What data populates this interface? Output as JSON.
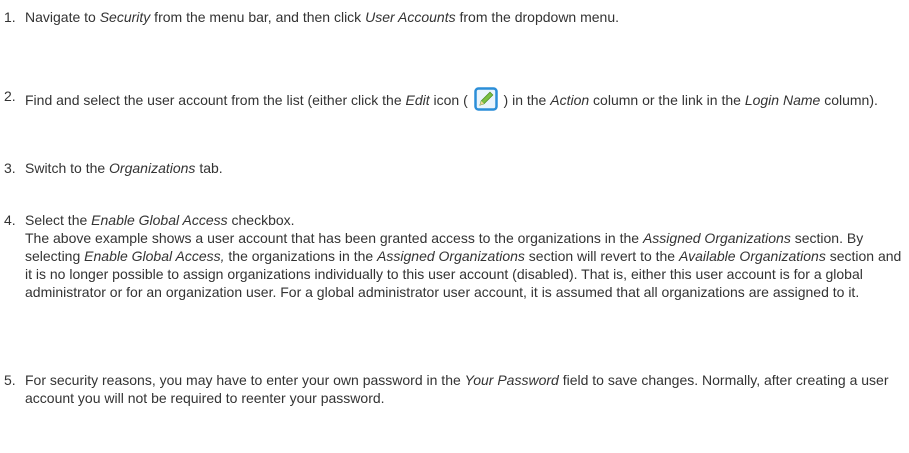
{
  "steps": [
    {
      "number": "1.",
      "parts": [
        "Navigate to ",
        "Security",
        " from the menu bar, and then click ",
        "User Accounts",
        " from the dropdown menu."
      ]
    },
    {
      "number": "2.",
      "parts": [
        "Find and select the user account from the list (either click the ",
        "Edit",
        " icon ( ",
        " ) in the ",
        "Action",
        " column or the link in the ",
        "Login Name",
        " column)."
      ],
      "icon": "edit-icon"
    },
    {
      "number": "3.",
      "parts": [
        "Switch to the ",
        "Organizations",
        " tab."
      ]
    },
    {
      "number": "4.",
      "parts": [
        "Select the ",
        "Enable Global Access",
        " checkbox."
      ],
      "detail_parts": [
        "The above example shows a user account that has been granted access to the organizations in the ",
        "Assigned Organizations",
        " section. By selecting ",
        "Enable Global Access,",
        " the organizations in the ",
        "Assigned Organizations",
        " section will revert to the ",
        "Available Organizations",
        " section and it is no longer possible to assign organizations individually to this user account (disabled). That is, either this user account is for a global administrator or for an organization user. For a global administrator user account, it is assumed that all organizations are assigned to it."
      ]
    },
    {
      "number": "5.",
      "parts": [
        "For security reasons, you may have to enter your own password in the ",
        "Your Password",
        " field to save changes. Normally, after creating a user account you will not be required to reenter your password."
      ]
    }
  ],
  "colors": {
    "text": "#333333",
    "icon_frame": "#2b8ed8",
    "icon_pencil": "#7bc043"
  }
}
